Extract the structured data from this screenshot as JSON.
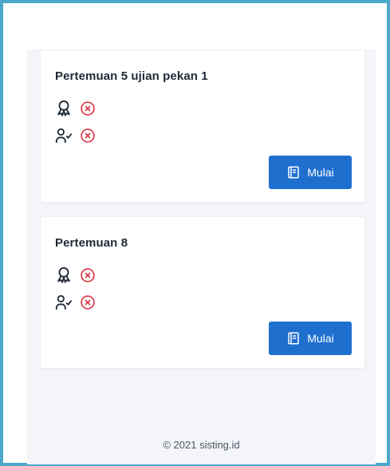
{
  "meetings": [
    {
      "title": "Pertemuan 5 ujian pekan 1",
      "certificate_icon": "award-icon",
      "certificate_status_icon": "x-circle-icon",
      "attendance_icon": "user-check-icon",
      "attendance_status_icon": "x-circle-icon",
      "button_icon": "book-icon",
      "button_label": "Mulai"
    },
    {
      "title": "Pertemuan 8",
      "certificate_icon": "award-icon",
      "certificate_status_icon": "x-circle-icon",
      "attendance_icon": "user-check-icon",
      "attendance_status_icon": "x-circle-icon",
      "button_icon": "book-icon",
      "button_label": "Mulai"
    }
  ],
  "footer": {
    "copyright": "© 2021 sisting.id"
  },
  "colors": {
    "frame_border": "#4aa9c9",
    "page_background": "#f3f5f8",
    "card_background": "#ffffff",
    "primary_button": "#1f6fcf",
    "status_negative": "#dc3545",
    "icon_dark": "#1f2937"
  }
}
